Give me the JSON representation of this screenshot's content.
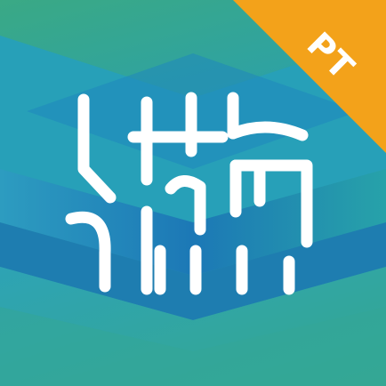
{
  "icon": {
    "badge_text": "PT",
    "logo_glyph": "lai-character-logo",
    "colors": {
      "green": "#36a987",
      "teal": "#2b9eb6",
      "blue": "#1e7fba",
      "deep_blue": "#1a6fae",
      "badge": "#f3a21a",
      "glyph": "#ffffff"
    }
  }
}
